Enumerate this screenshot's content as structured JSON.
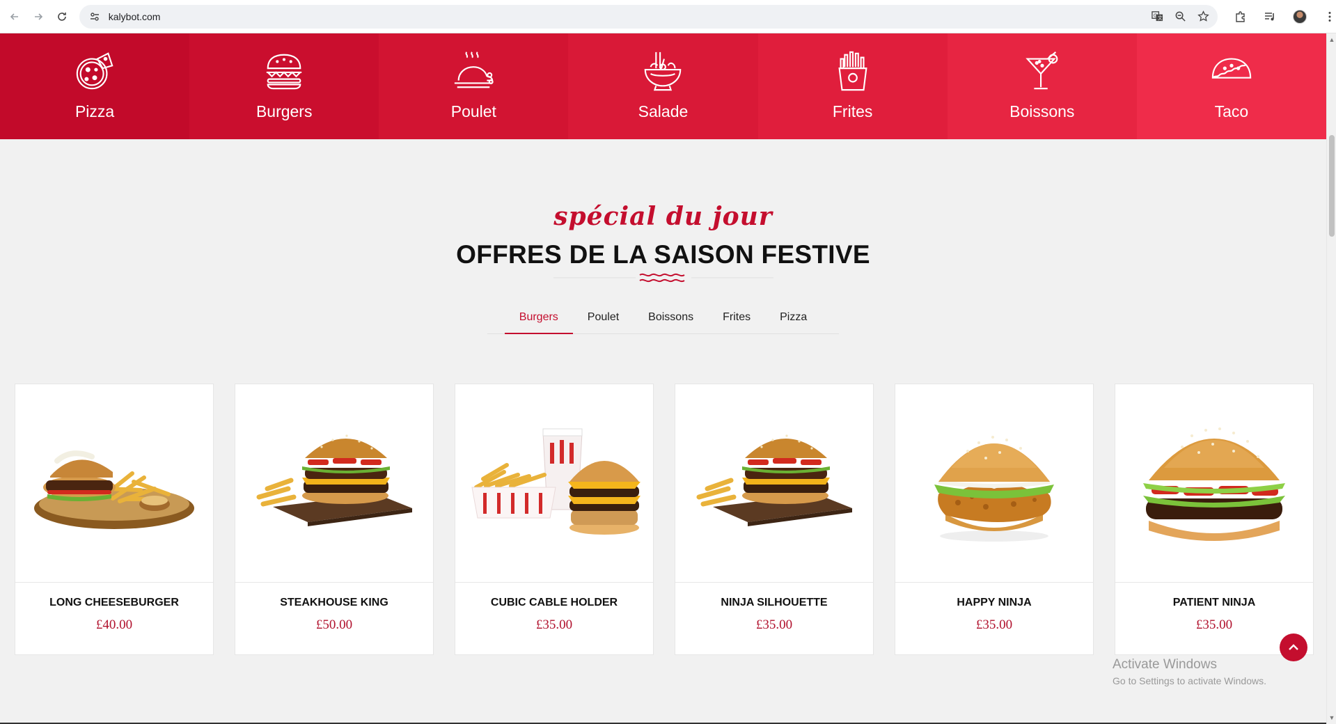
{
  "browser": {
    "url": "kalybot.com",
    "icons": [
      "back-arrow-icon",
      "forward-arrow-icon",
      "reload-icon",
      "site-settings-icon",
      "translate-icon",
      "zoom-icon",
      "star-icon",
      "extensions-icon",
      "media-icon",
      "profile-avatar",
      "more-icon"
    ]
  },
  "categories": [
    {
      "label": "Pizza",
      "icon": "pizza-icon",
      "color": "#c20a2a"
    },
    {
      "label": "Burgers",
      "icon": "burger-icon",
      "color": "#ca0e2e"
    },
    {
      "label": "Poulet",
      "icon": "chicken-icon",
      "color": "#d21432"
    },
    {
      "label": "Salade",
      "icon": "salad-icon",
      "color": "#d91937"
    },
    {
      "label": "Frites",
      "icon": "fries-icon",
      "color": "#e01e3c"
    },
    {
      "label": "Boissons",
      "icon": "cocktail-icon",
      "color": "#e72542"
    },
    {
      "label": "Taco",
      "icon": "taco-icon",
      "color": "#ef2c4a"
    }
  ],
  "section": {
    "script_title": "spécial du jour",
    "title": "OFFRES DE LA SAISON FESTIVE"
  },
  "tabs": [
    {
      "label": "Burgers",
      "active": true
    },
    {
      "label": "Poulet",
      "active": false
    },
    {
      "label": "Boissons",
      "active": false
    },
    {
      "label": "Frites",
      "active": false
    },
    {
      "label": "Pizza",
      "active": false
    }
  ],
  "products": [
    {
      "name": "LONG CHEESEBURGER",
      "price": "£40.00"
    },
    {
      "name": "STEAKHOUSE KING",
      "price": "£50.00"
    },
    {
      "name": "CUBIC CABLE HOLDER",
      "price": "£35.00"
    },
    {
      "name": "NINJA SILHOUETTE",
      "price": "£35.00"
    },
    {
      "name": "HAPPY NINJA",
      "price": "£35.00"
    },
    {
      "name": "PATIENT NINJA",
      "price": "£35.00"
    }
  ],
  "watermark": {
    "line1": "Activate Windows",
    "line2": "Go to Settings to activate Windows."
  },
  "colors": {
    "accent": "#c40e2e",
    "price": "#b0102c",
    "background": "#f1f1f1"
  }
}
